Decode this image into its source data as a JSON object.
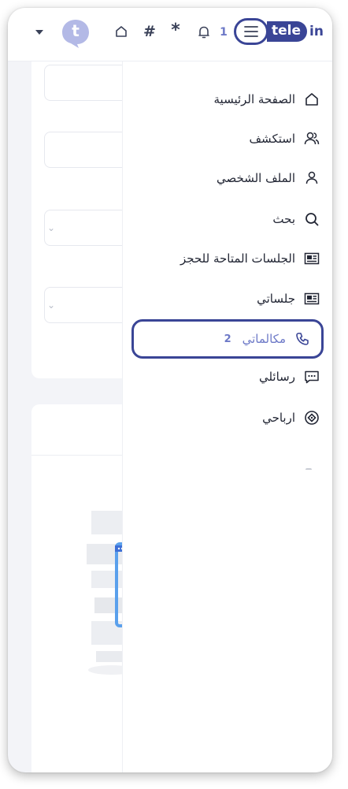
{
  "header": {
    "notification_count": "1",
    "logo": {
      "brand_pill": "tele",
      "brand_suffix": "in"
    },
    "avatar_letter": "t",
    "hash_symbol": "#",
    "star_symbol": "*"
  },
  "drawer": {
    "items": [
      {
        "label": "الصفحة الرئيسية",
        "icon": "home-icon"
      },
      {
        "label": "استكشف",
        "icon": "users-icon"
      },
      {
        "label": "الملف الشخصي",
        "icon": "user-icon"
      },
      {
        "label": "بحث",
        "icon": "search-icon"
      },
      {
        "label": "الجلسات المتاحة للحجز",
        "icon": "ticket-icon"
      },
      {
        "label": "جلساتي",
        "icon": "ticket-icon"
      },
      {
        "label": "مكالماتي",
        "icon": "phone-icon",
        "badge": "2",
        "active": true
      },
      {
        "label": "رسائلي",
        "icon": "chat-icon"
      },
      {
        "label": "ارباحي",
        "icon": "earnings-icon"
      }
    ]
  },
  "colors": {
    "accent": "#3a4596",
    "badge": "#6d79c7",
    "text": "#222634",
    "background": "#f3f4f8"
  }
}
